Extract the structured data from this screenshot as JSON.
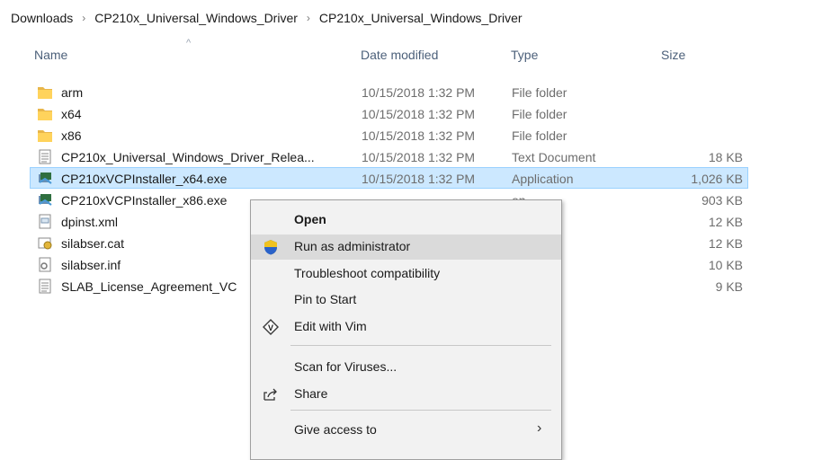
{
  "breadcrumb": [
    "Downloads",
    "CP210x_Universal_Windows_Driver",
    "CP210x_Universal_Windows_Driver"
  ],
  "columns": {
    "name": "Name",
    "date": "Date modified",
    "type": "Type",
    "size": "Size"
  },
  "files": [
    {
      "name": "arm",
      "date": "10/15/2018 1:32 PM",
      "type": "File folder",
      "size": "",
      "icon": "folder-icon"
    },
    {
      "name": "x64",
      "date": "10/15/2018 1:32 PM",
      "type": "File folder",
      "size": "",
      "icon": "folder-icon"
    },
    {
      "name": "x86",
      "date": "10/15/2018 1:32 PM",
      "type": "File folder",
      "size": "",
      "icon": "folder-icon"
    },
    {
      "name": "CP210x_Universal_Windows_Driver_Relea...",
      "date": "10/15/2018 1:32 PM",
      "type": "Text Document",
      "size": "18 KB",
      "icon": "text-document-icon"
    },
    {
      "name": "CP210xVCPInstaller_x64.exe",
      "date": "10/15/2018 1:32 PM",
      "type": "Application",
      "size": "1,026 KB",
      "icon": "installer-icon",
      "selected": true
    },
    {
      "name": "CP210xVCPInstaller_x86.exe",
      "date": "",
      "type": "on",
      "size": "903 KB",
      "icon": "installer-icon"
    },
    {
      "name": "dpinst.xml",
      "date": "",
      "type": "ument",
      "size": "12 KB",
      "icon": "xml-document-icon"
    },
    {
      "name": "silabser.cat",
      "date": "",
      "type": "Catalog",
      "size": "12 KB",
      "icon": "security-catalog-icon"
    },
    {
      "name": "silabser.inf",
      "date": "",
      "type": "ormation",
      "size": "10 KB",
      "icon": "setup-information-icon"
    },
    {
      "name": "SLAB_License_Agreement_VC",
      "date": "",
      "type": "ument",
      "size": "9 KB",
      "icon": "text-document-icon"
    }
  ],
  "context_menu": {
    "items": [
      {
        "label": "Open",
        "bold": true,
        "icon": ""
      },
      {
        "label": "Run as administrator",
        "icon": "uac-shield-icon",
        "hover": true
      },
      {
        "label": "Troubleshoot compatibility",
        "icon": ""
      },
      {
        "label": "Pin to Start",
        "icon": ""
      },
      {
        "label": "Edit with Vim",
        "icon": "vim-icon"
      },
      {
        "label": "Scan for Viruses...",
        "icon": ""
      },
      {
        "label": "Share",
        "icon": "share-icon"
      },
      {
        "label": "Give access to",
        "icon": "",
        "submenu": true
      }
    ]
  }
}
